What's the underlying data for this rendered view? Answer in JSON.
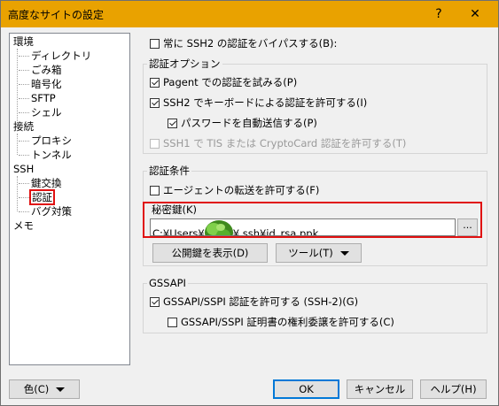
{
  "window": {
    "title": "高度なサイトの設定",
    "help_label": "?",
    "close_label": "✕"
  },
  "tree": {
    "items": [
      {
        "label": "環境"
      },
      {
        "label": "ディレクトリ"
      },
      {
        "label": "ごみ箱"
      },
      {
        "label": "暗号化"
      },
      {
        "label": "SFTP"
      },
      {
        "label": "シェル"
      },
      {
        "label": "接続"
      },
      {
        "label": "プロキシ"
      },
      {
        "label": "トンネル"
      },
      {
        "label": "SSH"
      },
      {
        "label": "鍵交換"
      },
      {
        "label": "認証",
        "selected": true
      },
      {
        "label": "バグ対策"
      },
      {
        "label": "メモ"
      }
    ]
  },
  "auth": {
    "bypass_label": "常に SSH2 の認証をバイパスする(B):",
    "options_group": "認証オプション",
    "pageant_label": "Pagent での認証を試みる(P)",
    "keyboard_label": "SSH2 でキーボードによる認証を許可する(I)",
    "password_auto_label": "パスワードを自動送信する(P)",
    "tis_label": "SSH1 で TIS または CryptoCard 認証を許可する(T)",
    "conditions_group": "認証条件",
    "agent_forward_label": "エージェントの転送を許可する(F)",
    "private_key_label": "秘密鍵(K)",
    "private_key_prefix": "C:¥Users¥",
    "private_key_suffix": "¥.ssh¥id_rsa.ppk",
    "browse_label": "...",
    "show_pubkey_label": "公開鍵を表示(D)",
    "tools_label": "ツール(T)",
    "gssapi_group": "GSSAPI",
    "gssapi_label": "GSSAPI/SSPI 認証を許可する (SSH-2)(G)",
    "gssapi_deleg_label": "GSSAPI/SSPI 証明書の権利委譲を許可する(C)"
  },
  "checks": {
    "bypass": false,
    "pageant": true,
    "keyboard": true,
    "password_auto": true,
    "tis": false,
    "agent_forward": false,
    "gssapi": true,
    "gssapi_deleg": false
  },
  "footer": {
    "color_label": "色(C)",
    "ok_label": "OK",
    "cancel_label": "キャンセル",
    "help_label": "ヘルプ(H)"
  },
  "colors": {
    "titlebar": "#e9a200",
    "highlight": "#e01010",
    "default_button_border": "#0078d7"
  }
}
